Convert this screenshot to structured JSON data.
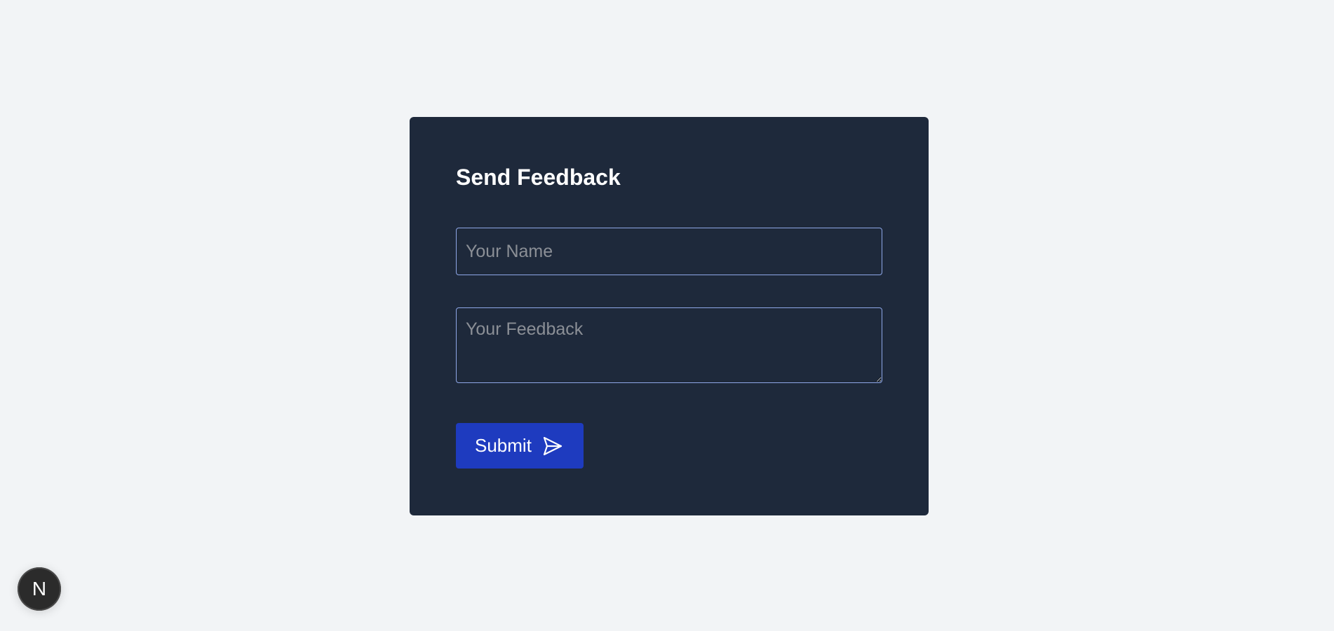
{
  "form": {
    "title": "Send Feedback",
    "name_placeholder": "Your Name",
    "feedback_placeholder": "Your Feedback",
    "submit_label": "Submit"
  },
  "dev_badge": {
    "label": "N",
    "icon": "nextjs-logo-icon"
  },
  "colors": {
    "page_background": "#f2f4f6",
    "card_background": "#1e293b",
    "field_border": "#8ea7e8",
    "button_background": "#1e3bbf",
    "text": "#ffffff",
    "placeholder": "#8b8f96"
  }
}
